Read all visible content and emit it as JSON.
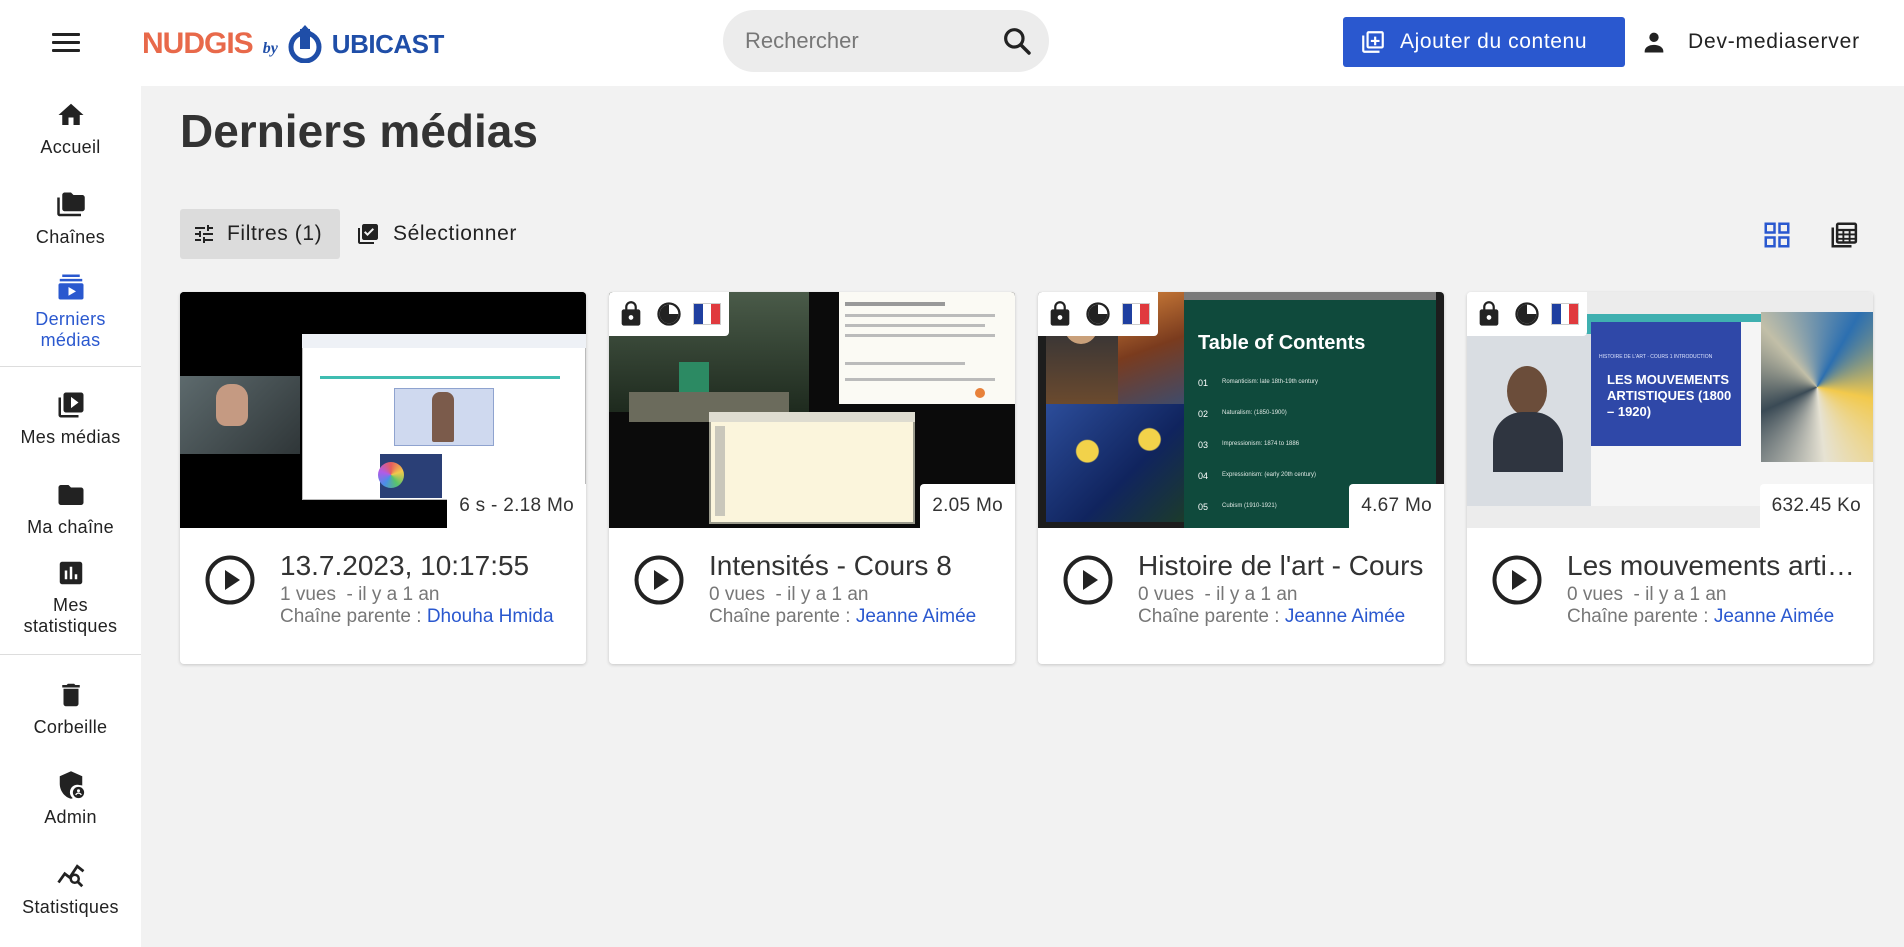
{
  "header": {
    "logo_nudgis": "NUDGIS",
    "logo_by": "by",
    "logo_ubicast": "UBICAST",
    "search_placeholder": "Rechercher",
    "add_content_label": "Ajouter du contenu",
    "user_name": "Dev-mediaserver"
  },
  "sidebar": {
    "items": [
      {
        "label": "Accueil",
        "icon": "home-icon"
      },
      {
        "label": "Chaînes",
        "icon": "folders-icon"
      },
      {
        "label": "Derniers médias",
        "icon": "latest-media-icon",
        "active": true
      },
      {
        "label": "Mes médias",
        "icon": "my-media-icon"
      },
      {
        "label": "Ma chaîne",
        "icon": "folder-icon"
      },
      {
        "label": "Mes statistiques",
        "icon": "my-stats-icon"
      },
      {
        "label": "Corbeille",
        "icon": "trash-icon"
      },
      {
        "label": "Admin",
        "icon": "admin-shield-icon"
      },
      {
        "label": "Statistiques",
        "icon": "statistics-icon"
      }
    ]
  },
  "main": {
    "title": "Derniers médias",
    "filters_label": "Filtres (1)",
    "select_label": "Sélectionner"
  },
  "colors": {
    "accent": "#2a58cf",
    "logo_orange": "#e8694a",
    "logo_blue": "#1f4ea8"
  },
  "cards": [
    {
      "title": "13.7.2023, 10:17:55",
      "views": "1 vues",
      "age": "- il y a 1 an",
      "parent_prefix": "Chaîne parente : ",
      "parent": "Dhouha Hmida",
      "size": "6 s - 2.18 Mo",
      "badges": []
    },
    {
      "title": "Intensités - Cours 8",
      "views": "0 vues",
      "age": "- il y a 1 an",
      "parent_prefix": "Chaîne parente : ",
      "parent": "Jeanne Aimée",
      "size": "2.05 Mo",
      "badges": [
        "lock-icon",
        "processing-icon",
        "french-flag-icon"
      ]
    },
    {
      "title": "Histoire de l'art - Cours",
      "views": "0 vues",
      "age": "- il y a 1 an",
      "parent_prefix": "Chaîne parente : ",
      "parent": "Jeanne Aimée",
      "size": "4.67 Mo",
      "badges": [
        "lock-icon",
        "processing-icon",
        "french-flag-icon"
      ],
      "thumb_heading": "Table of Contents",
      "thumb_items": [
        "Romanticism: late 18th-19th century",
        "Naturalism: (1850-1900)",
        "Impressionism: 1874 to 1886",
        "Expressionism: (early 20th century)",
        "Cubism (1910-1921)"
      ],
      "thumb_numbers": [
        "01",
        "02",
        "03",
        "04",
        "05"
      ]
    },
    {
      "title": "Les mouvements artistiques",
      "views": "0 vues",
      "age": "- il y a 1 an",
      "parent_prefix": "Chaîne parente : ",
      "parent": "Jeanne Aimée",
      "size": "632.45 Ko",
      "badges": [
        "lock-icon",
        "processing-icon",
        "french-flag-icon"
      ],
      "thumb_small": "HISTOIRE DE L'ART · COURS 1 INTRODUCTION",
      "thumb_heading": "LES MOUVEMENTS ARTISTIQUES (1800 – 1920)"
    }
  ]
}
